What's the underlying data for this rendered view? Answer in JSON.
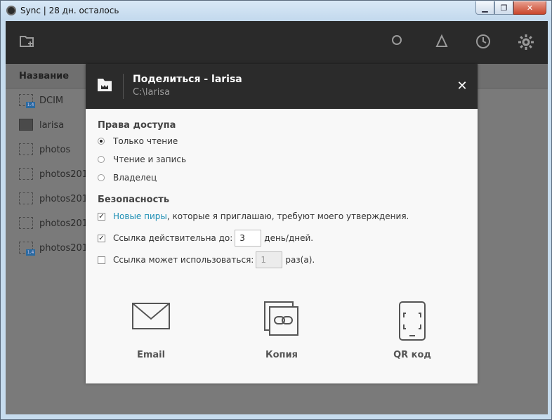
{
  "window": {
    "title": "Sync | 28 дн. осталось",
    "min": "▁",
    "max": "❐",
    "close": "✕"
  },
  "toolbar": {
    "add_folder_icon": "folder-plus-icon",
    "search_icon": "search-icon",
    "history_icon": "history-icon",
    "settings_icon": "gear-icon"
  },
  "files": {
    "column_name": "Название",
    "rows": [
      {
        "name": "DCIM"
      },
      {
        "name": "larisa"
      },
      {
        "name": "photos"
      },
      {
        "name": "photos201"
      },
      {
        "name": "photos201"
      },
      {
        "name": "photos201"
      },
      {
        "name": "photos201"
      }
    ],
    "badge": "1.4"
  },
  "dialog": {
    "title": "Поделиться - larisa",
    "path": "C:\\larisa",
    "close": "✕",
    "access": {
      "heading": "Права доступа",
      "options": [
        {
          "label": "Только чтение",
          "selected": true
        },
        {
          "label": "Чтение и запись",
          "selected": false
        },
        {
          "label": "Владелец",
          "selected": false
        }
      ]
    },
    "security": {
      "heading": "Безопасность",
      "approval_link": "Новые пиры",
      "approval_text": ", которые я приглашаю, требуют моего утверждения.",
      "approval_checked": true,
      "expiry_label": "Ссылка действительна до:",
      "expiry_value": "3",
      "expiry_unit": "день/дней.",
      "expiry_checked": true,
      "uses_label": "Ссылка может использоваться:",
      "uses_value": "1",
      "uses_unit": "раз(а).",
      "uses_checked": false
    },
    "share_options": [
      {
        "label": "Email",
        "icon": "envelope-icon"
      },
      {
        "label": "Копия",
        "icon": "copy-link-icon"
      },
      {
        "label": "QR код",
        "icon": "qr-code-icon"
      }
    ]
  }
}
